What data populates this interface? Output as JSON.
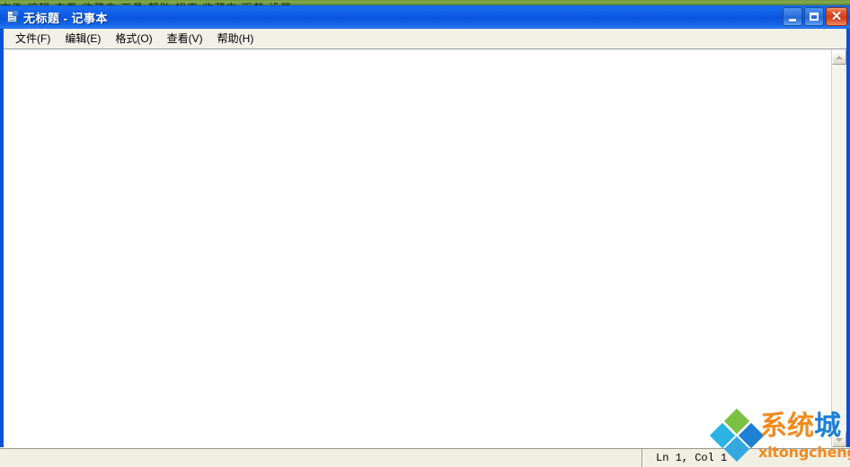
{
  "background_strip": {
    "ghost_text": "文件   编辑  查看   收藏夹   工具   帮助          搜索      收藏夹      下载      设置"
  },
  "window": {
    "title": "无标题 - 记事本",
    "title_icon": "notepad-document-icon",
    "controls": {
      "minimize_label": "_",
      "maximize_label": "❐",
      "close_label": "✕"
    }
  },
  "menu": {
    "items": [
      {
        "label": "文件(F)"
      },
      {
        "label": "编辑(E)"
      },
      {
        "label": "格式(O)"
      },
      {
        "label": "查看(V)"
      },
      {
        "label": "帮助(H)"
      }
    ]
  },
  "editor": {
    "content": "",
    "placeholder": ""
  },
  "scrollbars": {
    "vertical": {
      "up_arrow": "scroll-up-arrow-icon",
      "down_arrow": "scroll-down-arrow-icon"
    }
  },
  "status_bar": {
    "position_text": "Ln 1, Col 1"
  },
  "watermark": {
    "brand_cn_part1": "系统",
    "brand_cn_part2": "城",
    "url": "xitongcheng.com",
    "logo_colors": {
      "top": "#7ac143",
      "left": "#2bb3e4",
      "right": "#1e7fd4",
      "bottom": "#35a8e0"
    }
  },
  "colors": {
    "title_bar_blue": "#0a51d8",
    "close_button_red": "#d23c18",
    "menu_bar": "#f2f1e8",
    "status_bar": "#f1efe2",
    "client_white": "#ffffff",
    "watermark_orange": "#f08a1e"
  }
}
